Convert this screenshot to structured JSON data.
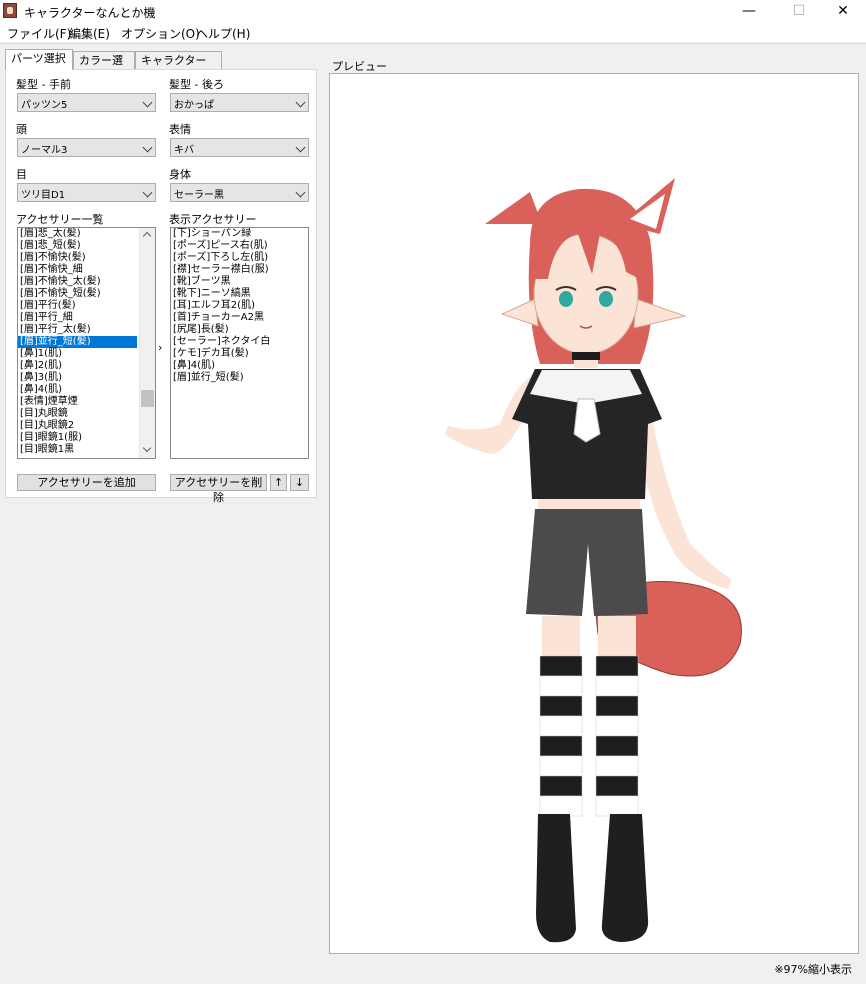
{
  "window": {
    "title": "キャラクターなんとか機",
    "minimize": "—",
    "maximize": "☐",
    "close": "✕"
  },
  "menu": [
    "ファイル(F)",
    "編集(E)",
    "オプション(O)",
    "ヘルプ(H)"
  ],
  "tabs": [
    "パーツ選択",
    "カラー選択",
    "キャラクター選択"
  ],
  "fields": {
    "hair_front": {
      "label": "髪型 - 手前",
      "value": "パッツン5"
    },
    "hair_back": {
      "label": "髪型 - 後ろ",
      "value": "おかっぱ"
    },
    "head": {
      "label": "頭",
      "value": "ノーマル3"
    },
    "expression": {
      "label": "表情",
      "value": "キバ"
    },
    "eyes": {
      "label": "目",
      "value": "ツリ目D1"
    },
    "body": {
      "label": "身体",
      "value": "セーラー黒"
    }
  },
  "accessory_list": {
    "label": "アクセサリー一覧",
    "items": [
      "[眉]悲_太(髪)",
      "[眉]悲_短(髪)",
      "[眉]不愉快(髪)",
      "[眉]不愉快_細",
      "[眉]不愉快_太(髪)",
      "[眉]不愉快_短(髪)",
      "[眉]平行(髪)",
      "[眉]平行_細",
      "[眉]平行_太(髪)",
      "[眉]並行_短(髪)",
      "[鼻]1(肌)",
      "[鼻]2(肌)",
      "[鼻]3(肌)",
      "[鼻]4(肌)",
      "[表情]煙草煙",
      "[目]丸眼鏡",
      "[目]丸眼鏡2",
      "[目]眼鏡1(服)",
      "[目]眼鏡1黒"
    ],
    "selected_index": 9
  },
  "display_accessories": {
    "label": "表示アクセサリー",
    "items": [
      "[下]ショーパン緑",
      "[ポーズ]ピース右(肌)",
      "[ポーズ]下ろし左(肌)",
      "[襟]セーラー襟白(服)",
      "[靴]ブーツ黒",
      "[靴下]ニーソ縞黒",
      "[耳]エルフ耳2(肌)",
      "[首]チョーカーA2黒",
      "[尻尾]長(髪)",
      "[セーラー]ネクタイ白",
      "[ケモ]デカ耳(髪)",
      "[鼻]4(肌)",
      "[眉]並行_短(髪)"
    ]
  },
  "move_arrow": "›",
  "buttons": {
    "add": "アクセサリーを追加",
    "remove": "アクセサリーを削除",
    "up": "↑",
    "down": "↓"
  },
  "preview": {
    "label": "プレビュー",
    "zoom_status": "※97%縮小表示"
  },
  "colors": {
    "hair": "#d9615a",
    "skin": "#fbe3d6",
    "shirt": "#252525",
    "collar": "#f4f4f4",
    "shorts": "#4b4b4b",
    "boots": "#1f1f1f",
    "selection": "#0078d7"
  }
}
